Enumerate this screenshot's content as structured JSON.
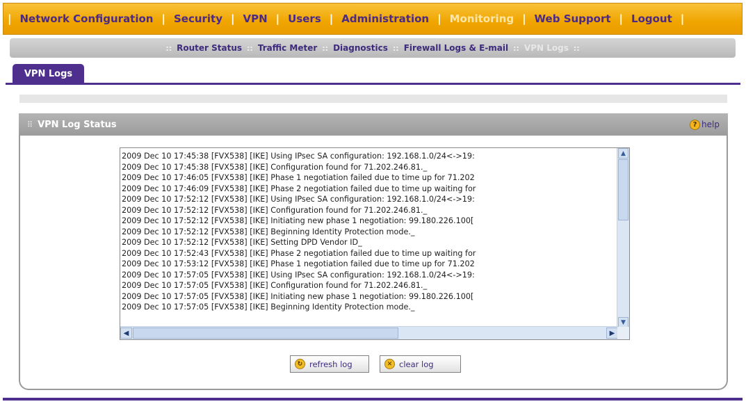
{
  "topnav": {
    "items": [
      {
        "label": "Network Configuration"
      },
      {
        "label": "Security"
      },
      {
        "label": "VPN"
      },
      {
        "label": "Users"
      },
      {
        "label": "Administration"
      },
      {
        "label": "Monitoring"
      },
      {
        "label": "Web Support"
      },
      {
        "label": "Logout"
      }
    ],
    "separator": "|",
    "active": "Monitoring"
  },
  "subnav": {
    "items": [
      {
        "label": "Router Status"
      },
      {
        "label": "Traffic Meter"
      },
      {
        "label": "Diagnostics"
      },
      {
        "label": "Firewall Logs & E-mail"
      },
      {
        "label": "VPN Logs"
      }
    ],
    "separator": "::",
    "active": "VPN Logs"
  },
  "tab": {
    "label": "VPN Logs"
  },
  "section": {
    "title": "VPN Log Status",
    "help_label": "help",
    "help_icon_glyph": "?"
  },
  "log": {
    "lines": [
      "2009 Dec 10 17:45:38 [FVX538] [IKE] Using IPsec SA configuration: 192.168.1.0/24<->19:",
      "2009 Dec 10 17:45:38 [FVX538] [IKE] Configuration found for 71.202.246.81._",
      "2009 Dec 10 17:46:05 [FVX538] [IKE] Phase 1 negotiation failed due to time up for 71.202",
      "2009 Dec 10 17:46:09 [FVX538] [IKE] Phase 2 negotiation failed due to time up waiting for",
      "2009 Dec 10 17:52:12 [FVX538] [IKE] Using IPsec SA configuration: 192.168.1.0/24<->19:",
      "2009 Dec 10 17:52:12 [FVX538] [IKE] Configuration found for 71.202.246.81._",
      "2009 Dec 10 17:52:12 [FVX538] [IKE] Initiating new phase 1 negotiation: 99.180.226.100[",
      "2009 Dec 10 17:52:12 [FVX538] [IKE] Beginning Identity Protection mode._",
      "2009 Dec 10 17:52:12 [FVX538] [IKE] Setting DPD Vendor ID_",
      "2009 Dec 10 17:52:43 [FVX538] [IKE] Phase 2 negotiation failed due to time up waiting for",
      "2009 Dec 10 17:53:12 [FVX538] [IKE] Phase 1 negotiation failed due to time up for 71.202",
      "2009 Dec 10 17:57:05 [FVX538] [IKE] Using IPsec SA configuration: 192.168.1.0/24<->19:",
      "2009 Dec 10 17:57:05 [FVX538] [IKE] Configuration found for 71.202.246.81._",
      "2009 Dec 10 17:57:05 [FVX538] [IKE] Initiating new phase 1 negotiation: 99.180.226.100[",
      "2009 Dec 10 17:57:05 [FVX538] [IKE] Beginning Identity Protection mode._"
    ]
  },
  "buttons": {
    "refresh_label": "refresh log",
    "clear_label": "clear log"
  },
  "icons": {
    "up": "▲",
    "down": "▼",
    "left": "◀",
    "right": "▶",
    "refresh": "↻",
    "clear": "✕",
    "grip": "⠿"
  },
  "colors": {
    "nav_orange": "#f0a500",
    "nav_text": "#4a2a86",
    "accent_purple": "#4e2f8e",
    "section_gray": "#9b9b9b",
    "help_yellow": "#f3b51a"
  }
}
